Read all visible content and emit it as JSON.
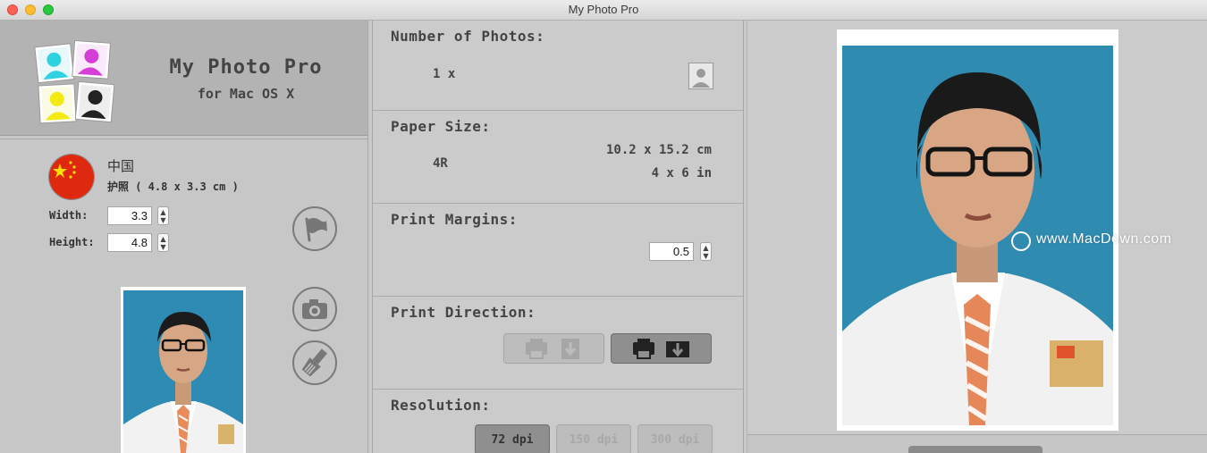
{
  "window": {
    "title": "My Photo Pro"
  },
  "app": {
    "name": "My Photo Pro",
    "subtitle": "for Mac OS X"
  },
  "country": {
    "name": "中国",
    "photo_type": "护照 ( 4.8 x 3.3 cm )",
    "flag_color": "#de2910"
  },
  "size": {
    "width_label": "Width:",
    "width_value": "3.3",
    "height_label": "Height:",
    "height_value": "4.8"
  },
  "number_of_photos": {
    "title": "Number of Photos:",
    "count": "1 x"
  },
  "paper_size": {
    "title": "Paper Size:",
    "name": "4R",
    "metric": "10.2 x 15.2 cm",
    "imperial": "4 x 6 in"
  },
  "print_margins": {
    "title": "Print Margins:",
    "value": "0.5"
  },
  "print_direction": {
    "title": "Print Direction:",
    "selected": "landscape"
  },
  "resolution": {
    "title": "Resolution:",
    "options": [
      "72 dpi",
      "150 dpi",
      "300 dpi"
    ],
    "selected": "72 dpi"
  },
  "watermark": {
    "text": "www.MacDown.com"
  },
  "colors": {
    "panel": "#c9c9c9",
    "header": "#b3b3b3",
    "photo_bg": "#2e8bb3"
  }
}
